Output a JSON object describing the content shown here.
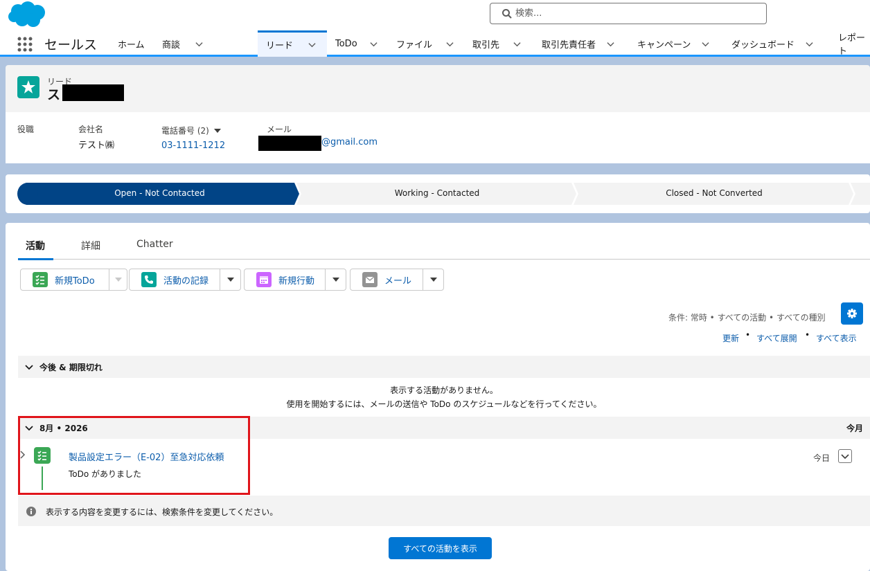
{
  "search": {
    "placeholder": "検索..."
  },
  "app": {
    "name": "セールス"
  },
  "nav": {
    "tabs": [
      {
        "label": "ホーム"
      },
      {
        "label": "商談"
      },
      {
        "label": "リード"
      },
      {
        "label": "ToDo"
      },
      {
        "label": "ファイル"
      },
      {
        "label": "取引先"
      },
      {
        "label": "取引先責任者"
      },
      {
        "label": "キャンペーン"
      },
      {
        "label": "ダッシュボード"
      },
      {
        "label": "レポート"
      }
    ]
  },
  "record": {
    "object_label": "リード",
    "name_visible": "ス",
    "fields": {
      "title_label": "役職",
      "company_label": "会社名",
      "company_value": "テスト㈱",
      "phone_label": "電話番号 (2)",
      "phone_value": "03-1111-1212",
      "email_label": "メール",
      "email_value_visible": "@gmail.com"
    }
  },
  "path": {
    "stages": [
      "Open - Not Contacted",
      "Working - Contacted",
      "Closed - Not Converted"
    ],
    "current_stage": "Open - Not Contacted"
  },
  "activity": {
    "tabs": [
      "活動",
      "詳細",
      "Chatter"
    ],
    "actions": [
      {
        "label": "新規ToDo",
        "icon": "task-icon",
        "color": "#3ba755"
      },
      {
        "label": "活動の記録",
        "icon": "log-call-icon",
        "color": "#06a59a"
      },
      {
        "label": "新規行動",
        "icon": "calendar-icon",
        "color": "#cb65ff"
      },
      {
        "label": "メール",
        "icon": "email-icon",
        "color": "#939393"
      }
    ],
    "filter_text": "条件: 常時 • すべての活動 • すべての種別",
    "links": {
      "refresh": "更新",
      "expand_all": "すべて展開",
      "view_all": "すべて表示"
    },
    "upcoming_group_title": "今後 & 期限切れ",
    "empty_line1": "表示する活動がありません。",
    "empty_line2": "使用を開始するには、メールの送信や ToDo のスケジュールなどを行ってください。",
    "month_group_title": "8月 • 2026",
    "month_group_right": "今月",
    "item": {
      "title": "製品設定エラー（E-02）至急対応依頼",
      "subtitle": "ToDo がありました",
      "date": "今日"
    },
    "info_text": "表示する内容を変更するには、検索条件を変更してください。",
    "show_all_button": "すべての活動を表示"
  },
  "colors": {
    "brand": "#0176d3",
    "path_current": "#014486",
    "highlight_box": "#e0151b"
  }
}
